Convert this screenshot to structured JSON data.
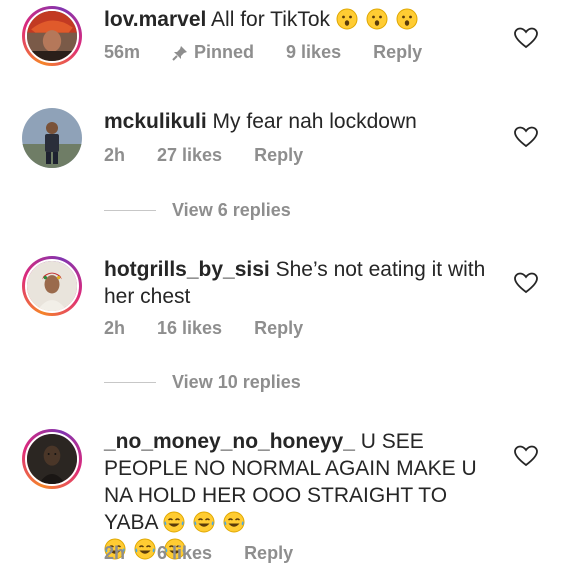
{
  "comments": [
    {
      "username": "lov.marvel",
      "text": "All for TikTok",
      "emoji_icon": "astonished-face-icon",
      "time": "56m",
      "pinned_label": "Pinned",
      "likes": "9 likes",
      "reply_label": "Reply"
    },
    {
      "username": "mckulikuli",
      "text": "My fear nah lockdown",
      "time": "2h",
      "likes": "27 likes",
      "reply_label": "Reply",
      "view_replies": "View 6 replies"
    },
    {
      "username": "hotgrills_by_sisi",
      "text": "She’s not eating it with her chest",
      "time": "2h",
      "likes": "16 likes",
      "reply_label": "Reply",
      "view_replies": "View 10 replies"
    },
    {
      "username": "_no_money_no_honeyy_",
      "text": "U SEE PEOPLE NO NORMAL AGAIN MAKE U NA HOLD HER OOO STRAIGHT TO YABA",
      "emoji_icon": "tears-of-joy-face-icon",
      "time": "2h",
      "likes": "6 likes",
      "reply_label": "Reply"
    }
  ],
  "colors": {
    "text": "#262626",
    "secondary": "#8e8e8e",
    "story_ring": "#dd2a7b",
    "emoji_yellow": "#ffcc33"
  }
}
